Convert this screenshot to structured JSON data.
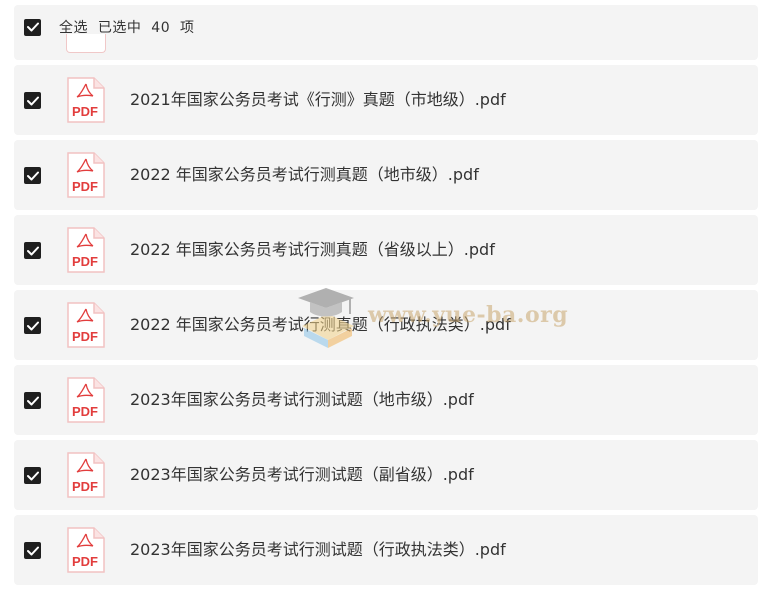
{
  "header": {
    "select_all_label": "全选  已选中  40  项",
    "checked": true
  },
  "files": [
    {
      "name": "2021年国家公务员考试《行测》真题（市地级）.pdf",
      "checked": true,
      "icon": "pdf-icon",
      "icon_label": "PDF"
    },
    {
      "name": "2022 年国家公务员考试行测真题（地市级）.pdf",
      "checked": true,
      "icon": "pdf-icon",
      "icon_label": "PDF"
    },
    {
      "name": "2022 年国家公务员考试行测真题（省级以上）.pdf",
      "checked": true,
      "icon": "pdf-icon",
      "icon_label": "PDF"
    },
    {
      "name": "2022 年国家公务员考试行测真题（行政执法类）.pdf",
      "checked": true,
      "icon": "pdf-icon",
      "icon_label": "PDF"
    },
    {
      "name": "2023年国家公务员考试行测试题（地市级）.pdf",
      "checked": true,
      "icon": "pdf-icon",
      "icon_label": "PDF"
    },
    {
      "name": "2023年国家公务员考试行测试题（副省级）.pdf",
      "checked": true,
      "icon": "pdf-icon",
      "icon_label": "PDF"
    },
    {
      "name": "2023年国家公务员考试行测试题（行政执法类）.pdf",
      "checked": true,
      "icon": "pdf-icon",
      "icon_label": "PDF"
    }
  ],
  "watermark": {
    "text": "www.yue-ba.org"
  },
  "colors": {
    "checkbox_fill": "#1f1f1f",
    "row_background": "#f4f4f4",
    "pdf_accent": "#e23d3d",
    "text": "#333333"
  }
}
